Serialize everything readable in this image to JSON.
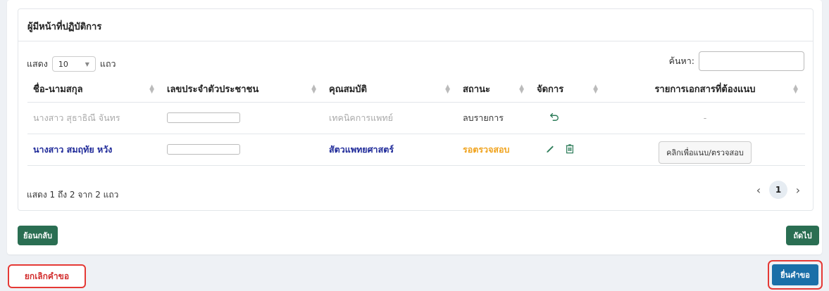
{
  "card": {
    "title": "ผู้มีหน้าที่ปฏิบัติการ"
  },
  "controls": {
    "show_label": "แสดง",
    "length_value": "10",
    "rows_label": "แถว",
    "search_label": "ค้นหา:",
    "search_value": ""
  },
  "table": {
    "headers": [
      "ชื่อ-นามสกุล",
      "เลขประจำตัวประชาชน",
      "คุณสมบัติ",
      "สถานะ",
      "จัดการ",
      "รายการเอกสารที่ต้องแนบ"
    ],
    "rows": [
      {
        "name": "นางสาว สุธาธิณี จันทร",
        "id_value": "",
        "qualification": "เทคนิคการแพทย์",
        "status": "ลบรายการ",
        "action_icon": "undo-icon",
        "documents": "-"
      },
      {
        "name": "นางสาว สมฤทัย หวัง",
        "id_value": "",
        "qualification": "สัตวแพทยศาสตร์",
        "status": "รอตรวจสอบ",
        "action_icons": [
          "edit-icon",
          "trash-icon"
        ],
        "documents_button": "คลิกเพื่อแนบ/ตรวจสอบ"
      }
    ]
  },
  "pagination": {
    "info": "แสดง 1 ถึง 2 จาก 2 แถว",
    "current_page": "1"
  },
  "buttons": {
    "back": "ย้อนกลับ",
    "next": "ถัดไป",
    "cancel": "ยกเลิกคำขอ",
    "submit": "ยื่นคำขอ"
  },
  "colors": {
    "green": "#2a6e52",
    "blue": "#1a6fa8",
    "pending": "#f0a31e",
    "danger": "#e53935",
    "link": "#1f2a99"
  }
}
